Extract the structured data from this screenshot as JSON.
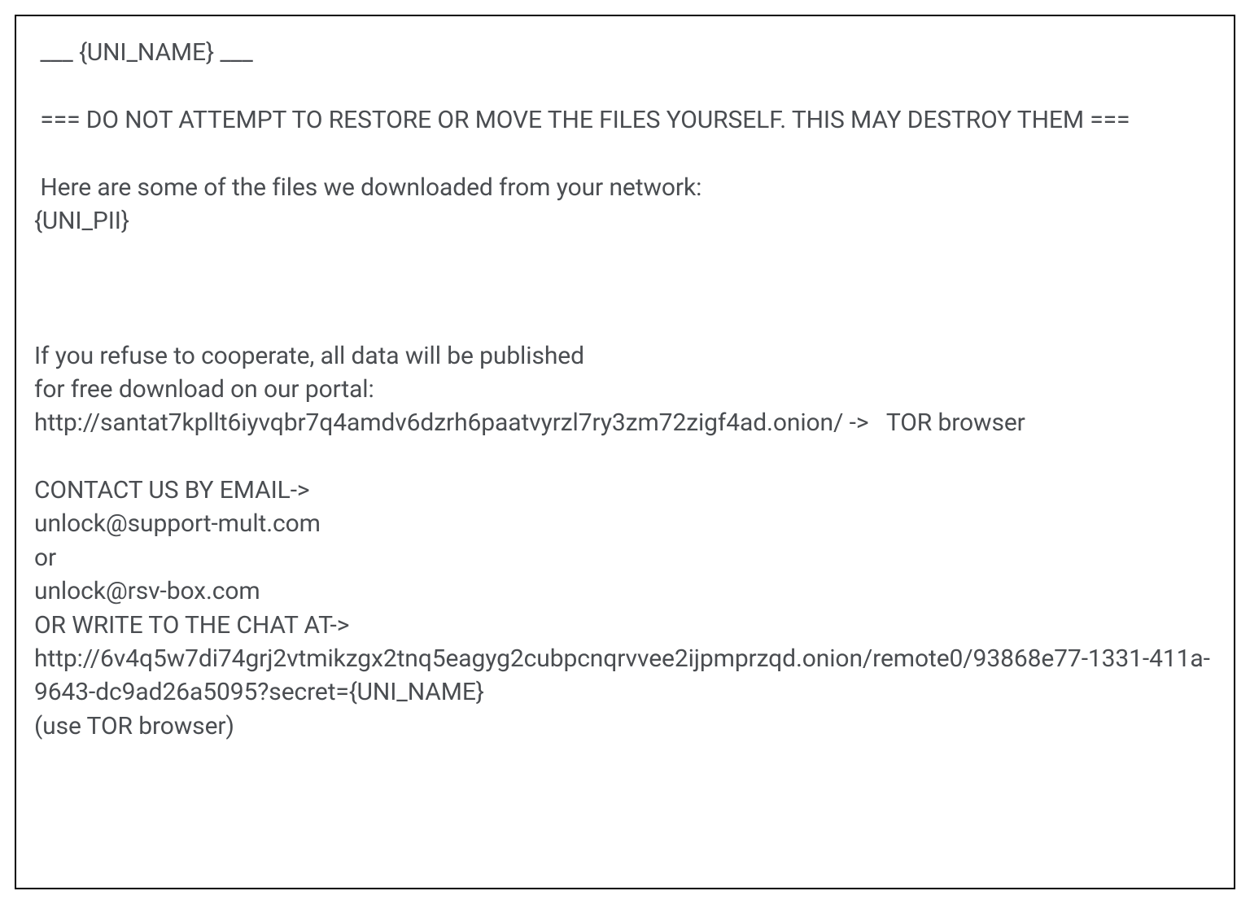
{
  "note": {
    "line_header": " ___ {UNI_NAME} ___",
    "blank1": "",
    "line_warning": " === DO NOT ATTEMPT TO RESTORE OR MOVE THE FILES YOURSELF. THIS MAY DESTROY THEM ===",
    "blank2": "",
    "line_files_intro": " Here are some of the files we downloaded from your network:",
    "line_pii": "{UNI_PII}",
    "blank3": "",
    "blank4": "",
    "blank5": "",
    "line_refuse1": "If you refuse to cooperate, all data will be published",
    "line_refuse2": "for free download on our portal:",
    "line_portal": "http://santat7kpllt6iyvqbr7q4amdv6dzrh6paatvyrzl7ry3zm72zigf4ad.onion/ ->   TOR browser",
    "blank6": "",
    "line_contact_header": "CONTACT US BY EMAIL->",
    "line_email1": "unlock@support-mult.com",
    "line_or": "or",
    "line_email2": "unlock@rsv-box.com",
    "line_chat_header": "OR WRITE TO THE CHAT AT->",
    "line_chat_url": "http://6v4q5w7di74grj2vtmikzgx2tnq5eagyg2cubpcnqrvvee2ijpmprzqd.onion/remote0/93868e77-1331-411a-9643-dc9ad26a5095?secret={UNI_NAME}",
    "line_tor": "(use TOR browser)"
  }
}
